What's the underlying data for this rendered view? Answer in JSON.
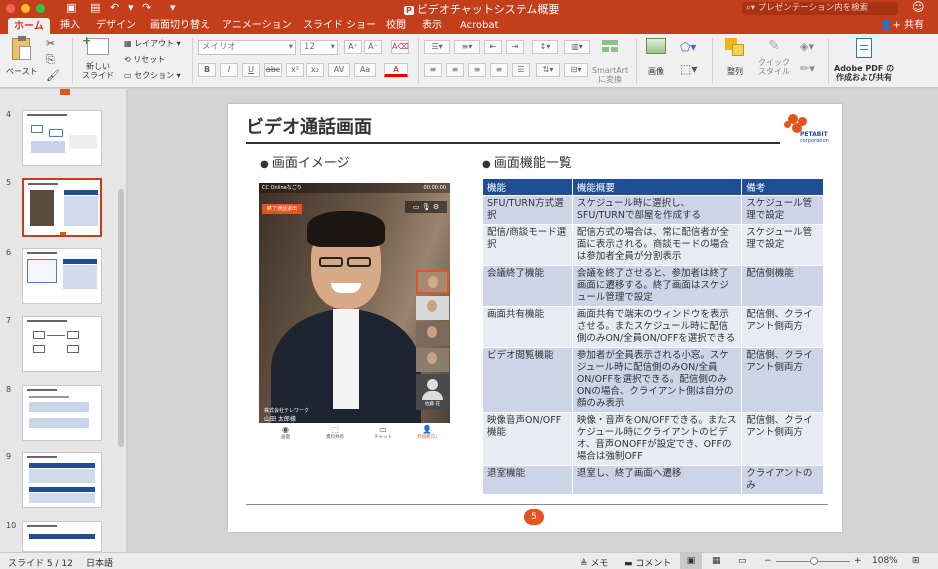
{
  "window": {
    "title": "ビデオチャットシステム概要",
    "search_placeholder": "プレゼンテーション内を検索"
  },
  "tabs": [
    "ホーム",
    "挿入",
    "デザイン",
    "画面切り替え",
    "アニメーション",
    "スライド ショー",
    "校閲",
    "表示",
    "Acrobat"
  ],
  "share_label": "共有",
  "ribbon": {
    "paste": "ペースト",
    "new_slide_line1": "新しい",
    "new_slide_line2": "スライド",
    "layout": "レイアウト",
    "reset": "リセット",
    "section": "セクション",
    "font_name": "メイリオ",
    "font_size": "12",
    "smartart_line1": "SmartArt",
    "smartart_line2": "に変換",
    "picture": "画像",
    "arrange": "整列",
    "quick_styles_line1": "クイック",
    "quick_styles_line2": "スタイル",
    "adobe_line1": "Adobe PDF の",
    "adobe_line2": "作成および共有"
  },
  "thumbnails": [
    {
      "num": "4"
    },
    {
      "num": "5"
    },
    {
      "num": "6"
    },
    {
      "num": "7"
    },
    {
      "num": "8"
    },
    {
      "num": "9"
    },
    {
      "num": "10"
    }
  ],
  "slide": {
    "title": "ビデオ通話画面",
    "bullet_left": "画面イメージ",
    "bullet_right": "画面機能一覧",
    "logo_main": "PETABIT",
    "logo_sub": "corporation",
    "page_number": "5",
    "video": {
      "header_title": "CC Onlineなごり",
      "header_time": "00:00:00",
      "end_button": "終了通話退出",
      "caller_company": "株式会社テレワーク",
      "caller_name": "山田 太郎様",
      "tile_name": "佐藤 花",
      "bottom_controls": [
        "画面",
        "資料共有",
        "チャット",
        "参加者(5)"
      ]
    },
    "table": {
      "headers": [
        "機能",
        "機能概要",
        "備考"
      ],
      "rows": [
        {
          "feature": "SFU/TURN方式選択",
          "summary": "スケジュール時に選択し、SFU/TURNで部屋を作成する",
          "note": "スケジュール管理で設定"
        },
        {
          "feature": "配信/商談モード選択",
          "summary": "配信方式の場合は、常に配信者が全面に表示される。商談モードの場合は参加者全員が分割表示",
          "note": "スケジュール管理で設定"
        },
        {
          "feature": "会議終了機能",
          "summary": "会議を終了させると、参加者は終了画面に遷移する。終了画面はスケジュール管理で設定",
          "note": "配信側機能"
        },
        {
          "feature": "画面共有機能",
          "summary": "画面共有で端末のウィンドウを表示させる。またスケジュール時に配信側のみON/全員ON/OFFを選択できる",
          "note": "配信側、クライアント側両方"
        },
        {
          "feature": "ビデオ閲覧機能",
          "summary": "参加者が全員表示される小窓。スケジュール時に配信側のみON/全員ON/OFFを選択できる。配信側のみONの場合、クライアント側は自分の顔のみ表示",
          "note": "配信側、クライアント側両方"
        },
        {
          "feature": "映像音声ON/OFF機能",
          "summary": "映像・音声をON/OFFできる。またスケジュール時にクライアントのビデオ、音声ONOFFが設定でき、OFFの場合は強制OFF",
          "note": "配信側、クライアント側両方"
        },
        {
          "feature": "退室機能",
          "summary": "退室し、終了画面へ遷移",
          "note": "クライアントのみ"
        }
      ]
    }
  },
  "status": {
    "slide_info": "スライド 5 / 12",
    "language": "日本語",
    "notes": "メモ",
    "comments": "コメント",
    "zoom": "108%"
  },
  "colors": {
    "accent": "#c43e1c",
    "table_header": "#1f4e96",
    "page_badge": "#e4541c"
  }
}
